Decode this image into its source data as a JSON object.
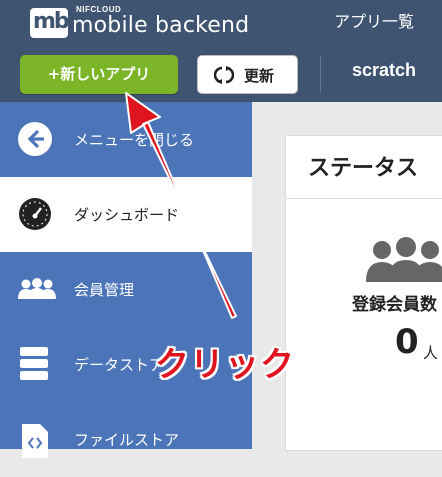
{
  "header": {
    "brand_small": "NIFCLOUD",
    "brand_name": "mobile backend",
    "logo_mark": "mb",
    "app_list_link": "アプリ一覧"
  },
  "toolbar": {
    "new_app_button": "+新しいアプリ",
    "refresh_button": "更新",
    "app_name": "scratch"
  },
  "sidebar": {
    "items": [
      {
        "label": "メニューを閉じる",
        "icon": "arrow-left-circle-icon"
      },
      {
        "label": "ダッシュボード",
        "icon": "gauge-icon"
      },
      {
        "label": "会員管理",
        "icon": "users-icon"
      },
      {
        "label": "データストア",
        "icon": "database-icon"
      },
      {
        "label": "ファイルストア",
        "icon": "file-code-icon"
      }
    ]
  },
  "main": {
    "status_title": "ステータス",
    "registered_members_label": "登録会員数",
    "registered_members_count": "0",
    "registered_members_unit": "人"
  },
  "annotation": {
    "text": "クリック",
    "color": "#e0141e"
  },
  "colors": {
    "header_bg": "#3f5470",
    "sidebar_bg": "#4c74b8",
    "new_button": "#7cb528",
    "annotation_red": "#e0141e"
  }
}
